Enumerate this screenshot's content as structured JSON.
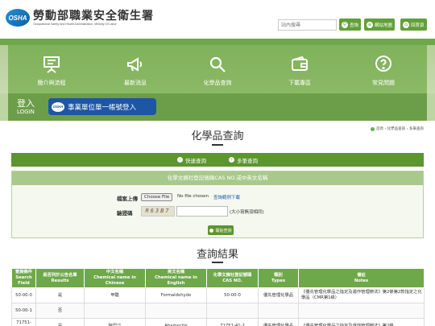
{
  "header": {
    "logo_badge": "OSHA",
    "logo_title": "勞動部職業安全衛生署",
    "logo_subtitle": "Occupational Safety And Health Administration, Ministry Of Labor",
    "search_placeholder": "站內搜尋",
    "search_button": "查詢",
    "sitemap_button": "網站地圖",
    "home_button": "回首頁"
  },
  "nav": {
    "items": [
      {
        "label": "簡介與流程",
        "icon": "presentation-board-icon"
      },
      {
        "label": "最新消息",
        "icon": "megaphone-icon"
      },
      {
        "label": "化學品查詢",
        "icon": "magnifier-icon"
      },
      {
        "label": "下載專區",
        "icon": "wallet-icon"
      },
      {
        "label": "常見問題",
        "icon": "question-bubble-icon"
      }
    ]
  },
  "login": {
    "label_zh": "登入",
    "label_en": "LOGIN",
    "single_login_badge": "OSHA",
    "single_login_button": "事業單位單一帳號登入"
  },
  "page": {
    "title": "化學品查詢",
    "breadcrumb": [
      "首頁",
      "化學品查詢",
      "多筆查詢"
    ]
  },
  "query_tabs": {
    "quick": "快速查詢",
    "multi": "多筆查詢"
  },
  "form": {
    "heading": "化學文摘社登記號碼CAS NO.或中英文名稱",
    "file_label": "檔案上傳",
    "file_button": "Choose File",
    "file_status": "No file chosen",
    "sample_link": "查詢範例下載",
    "captcha_label": "驗證碼",
    "captcha_value": "R63B7",
    "captcha_hint": "(大小寫無須相同)",
    "submit": "開始查詢"
  },
  "results": {
    "title": "查詢結果",
    "columns": [
      {
        "zh": "查詢條件",
        "en": "Search Field"
      },
      {
        "zh": "是否列於公告名單",
        "en": "Results"
      },
      {
        "zh": "中文名稱",
        "en": "Chemical name in Chinese"
      },
      {
        "zh": "英文名稱",
        "en": "Chemical name in English"
      },
      {
        "zh": "化學文摘社登記號碼",
        "en": "CAS NO."
      },
      {
        "zh": "類別",
        "en": "Types"
      },
      {
        "zh": "備註",
        "en": "Notes"
      }
    ],
    "rows": [
      [
        "50-00-0",
        "是",
        "甲醛",
        "Formaldehyde",
        "50-00-0",
        "優先管理化學品",
        "《優先管理化學品之指定及運作管理辦法》第2條第2款指定之化學品（CMR第1級）"
      ],
      [
        "50-00-1",
        "否",
        "",
        "",
        "",
        "",
        ""
      ],
      [
        "71751-41-2",
        "是",
        "阿巴汀",
        "Abamectin",
        "71751-41-2",
        "優先管理化學品",
        "《優先管理化學品之指定及運作管理辦法》第2條"
      ]
    ]
  },
  "colors": {
    "brand_green": "#6ea84a",
    "dark_green": "#5d952f",
    "login_blue": "#1d56a3"
  }
}
